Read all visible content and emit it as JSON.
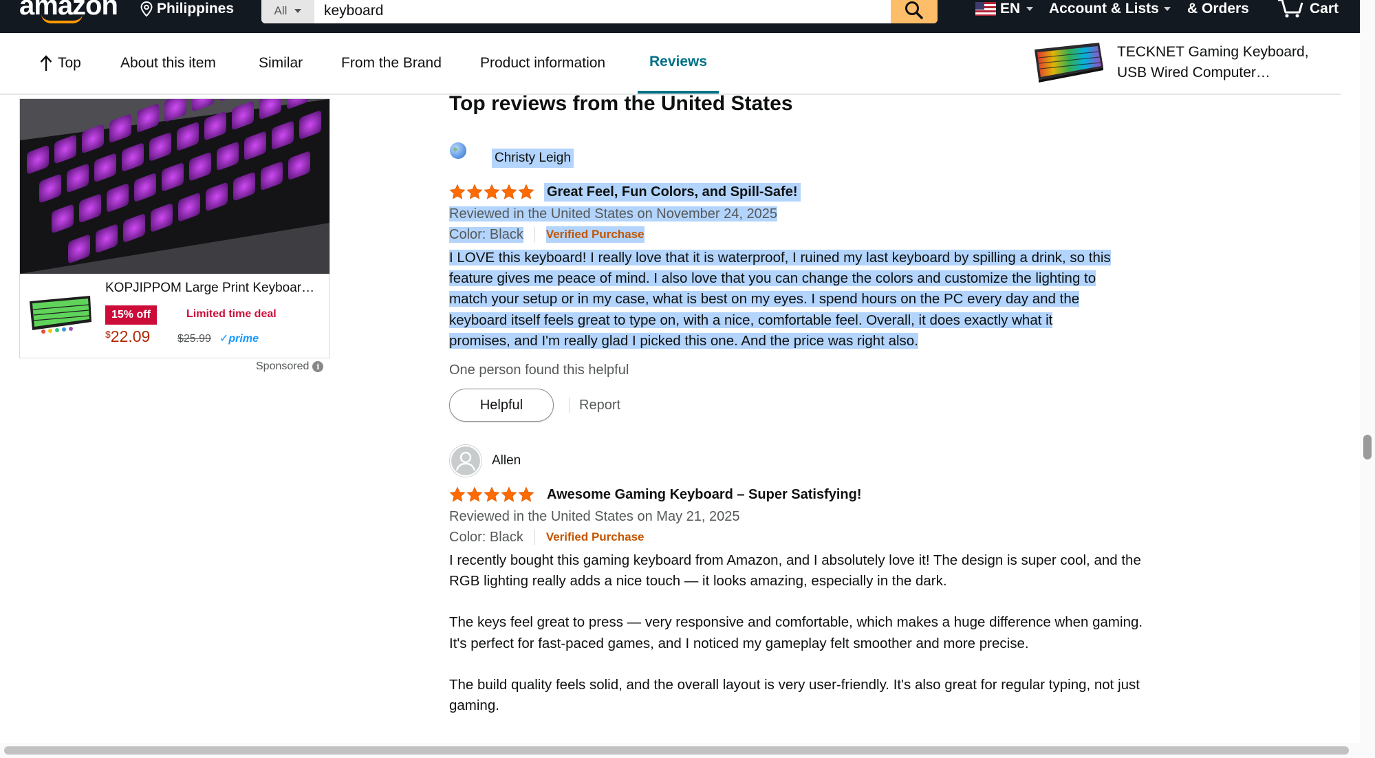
{
  "header": {
    "logo": "amazon",
    "deliver_location": "Philippines",
    "search_category": "All",
    "search_value": "keyboard",
    "language": "EN",
    "account_label": "Account & Lists",
    "orders_label": "& Orders",
    "cart_label": "Cart"
  },
  "subnav": {
    "items": [
      "Top",
      "About this item",
      "Similar",
      "From the Brand",
      "Product information",
      "Reviews"
    ],
    "active": "Reviews",
    "sticky_product_title": "TECKNET Gaming Keyboard, USB Wired Computer…"
  },
  "ad": {
    "title": "KOPJIPPOM Large Print Keyboar…",
    "discount_badge": "15% off",
    "deal_label": "Limited time deal",
    "currency": "$",
    "price": "22.09",
    "list_price": "$25.99",
    "prime": "prime",
    "sponsored_label": "Sponsored"
  },
  "reviews": {
    "heading": "Top reviews from the United States",
    "items": [
      {
        "reviewer": "Christy Leigh",
        "rating": 5,
        "title": "Great Feel, Fun Colors, and Spill-Safe!",
        "date": "Reviewed in the United States on November 24, 2025",
        "color": "Color: Black",
        "verified": "Verified Purchase",
        "body": [
          "I LOVE this keyboard! I really love that it is waterproof, I ruined my last keyboard by spilling a drink, so this",
          "feature gives me peace of mind. I also love that you can change the colors and customize the lighting to",
          "match your setup or in my case, what is best on my eyes. I spend hours on the PC every day and the",
          "keyboard itself feels great to type on, with a nice, comfortable feel. Overall, it does exactly what it",
          "promises, and I'm really glad I picked this one. And the price was right also."
        ],
        "helpful_count": "One person found this helpful",
        "helpful_button": "Helpful",
        "report": "Report"
      },
      {
        "reviewer": "Allen",
        "rating": 5,
        "title": "Awesome Gaming Keyboard – Super Satisfying!",
        "date": "Reviewed in the United States on May 21, 2025",
        "color": "Color: Black",
        "verified": "Verified Purchase",
        "paragraphs": [
          "I recently bought this gaming keyboard from Amazon, and I absolutely love it! The design is super cool, and the RGB lighting really adds a nice touch — it looks amazing, especially in the dark.",
          "The keys feel great to press — very responsive and comfortable, which makes a huge difference when gaming. It's perfect for fast-paced games, and I noticed my gameplay felt smoother and more precise.",
          "The build quality feels solid, and the overall layout is very user-friendly. It's also great for regular typing, not just gaming."
        ]
      }
    ]
  },
  "colors": {
    "header_bg": "#131921",
    "link_teal": "#007185",
    "star_orange": "#ff6b00",
    "verified_orange": "#c45500",
    "price_red": "#b12704",
    "deal_red": "#cc0c39",
    "selection": "#b3d4fc"
  },
  "icons": [
    "location-pin-icon",
    "search-icon",
    "flag-us-icon",
    "cart-icon",
    "up-arrow-icon",
    "info-icon",
    "star-icon",
    "avatar-icon"
  ]
}
